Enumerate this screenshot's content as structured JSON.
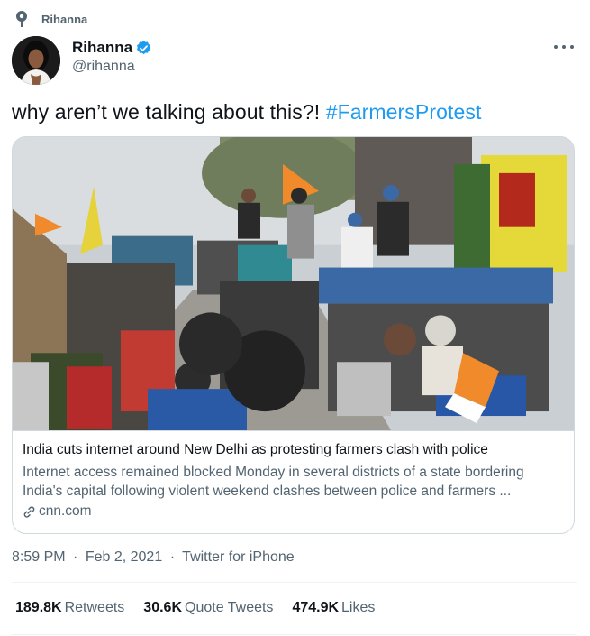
{
  "pinned": {
    "label": "Rihanna",
    "icon": "pin-icon"
  },
  "author": {
    "display_name": "Rihanna",
    "handle": "@rihanna",
    "verified": true,
    "verified_color": "#1d9bf0",
    "avatar_icon": "profile-photo"
  },
  "tweet": {
    "text_prefix": "why aren’t we talking about this?!",
    "hashtag": "#FarmersProtest",
    "hashtag_color": "#1d9bf0"
  },
  "card": {
    "image_description_icon": "news-photo",
    "title": "India cuts internet around New Delhi as protesting farmers clash with police",
    "description": "Internet access remained blocked Monday in several districts of a state bordering India's capital following violent weekend clashes between police and farmers ...",
    "domain": "cnn.com",
    "domain_icon": "link-icon"
  },
  "meta": {
    "time": "8:59 PM",
    "date": "Feb 2, 2021",
    "separator": "·",
    "source": "Twitter for iPhone"
  },
  "stats": {
    "retweets_count": "189.8K",
    "retweets_label": "Retweets",
    "quotes_count": "30.6K",
    "quotes_label": "Quote Tweets",
    "likes_count": "474.9K",
    "likes_label": "Likes"
  }
}
